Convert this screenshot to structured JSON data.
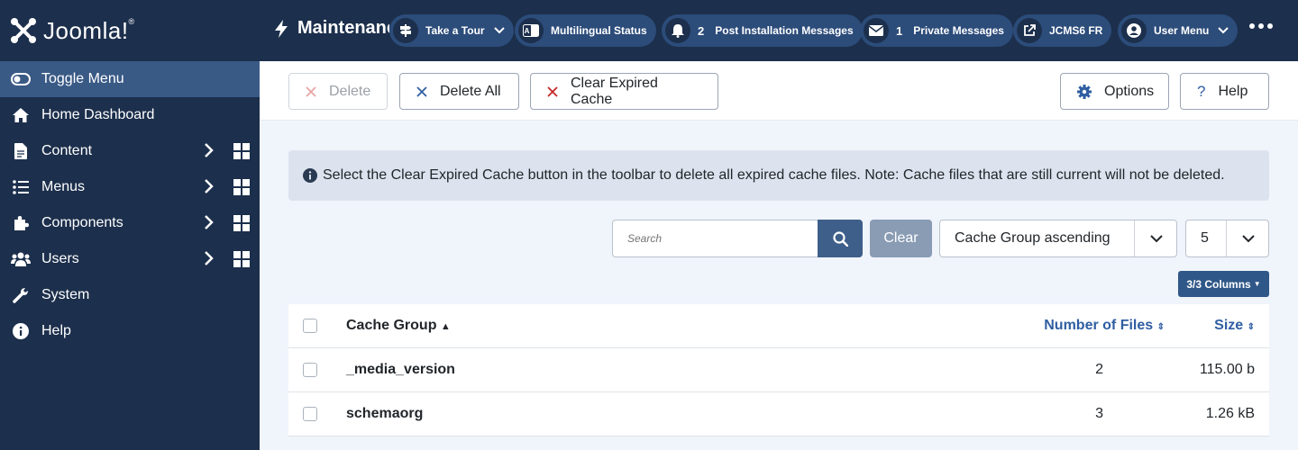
{
  "brand": {
    "name": "Joomla!",
    "mark": "®"
  },
  "sidebar": {
    "items": [
      {
        "label": "Toggle Menu",
        "icon": "toggle-icon",
        "active": true
      },
      {
        "label": "Home Dashboard",
        "icon": "home-icon"
      },
      {
        "label": "Content",
        "icon": "file-icon",
        "submenu": true
      },
      {
        "label": "Menus",
        "icon": "list-icon",
        "submenu": true
      },
      {
        "label": "Components",
        "icon": "puzzle-icon",
        "submenu": true
      },
      {
        "label": "Users",
        "icon": "users-icon",
        "submenu": true
      },
      {
        "label": "System",
        "icon": "wrench-icon"
      },
      {
        "label": "Help",
        "icon": "info-icon"
      }
    ]
  },
  "header": {
    "title": "Maintenance: Clear Cache",
    "pills": [
      {
        "label": "Take a Tour",
        "icon": "signpost-icon"
      },
      {
        "label": "Multilingual Status",
        "icon": "language-icon"
      },
      {
        "label": "Post Installation Messages",
        "icon": "bell-icon",
        "count": "2"
      },
      {
        "label": "Private Messages",
        "icon": "envelope-icon",
        "count": "1"
      },
      {
        "label": "JCMS6 FR",
        "icon": "external-link-icon"
      },
      {
        "label": "User Menu",
        "icon": "user-icon"
      }
    ]
  },
  "toolbar": {
    "delete": "Delete",
    "delete_all": "Delete All",
    "clear_expired": "Clear Expired Cache",
    "options": "Options",
    "help": "Help"
  },
  "alert": {
    "text": "Select the Clear Expired Cache button in the toolbar to delete all expired cache files. Note: Cache files that are still current will not be deleted."
  },
  "filters": {
    "search_placeholder": "Search",
    "clear": "Clear",
    "ordering": "Cache Group ascending",
    "limit": "5",
    "columns": "3/3 Columns"
  },
  "table": {
    "headers": {
      "group": "Cache Group",
      "files": "Number of Files",
      "size": "Size"
    },
    "rows": [
      {
        "group": "_media_version",
        "files": "2",
        "size": "115.00 b"
      },
      {
        "group": "schemaorg",
        "files": "3",
        "size": "1.26 kB"
      }
    ]
  }
}
